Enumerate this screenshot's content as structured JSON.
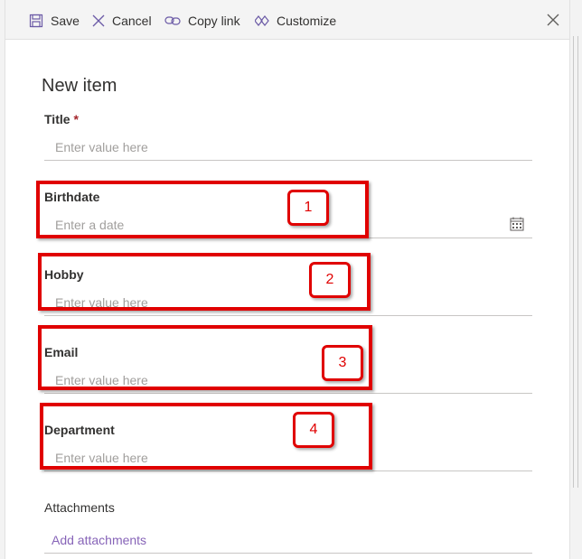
{
  "toolbar": {
    "save_label": "Save",
    "cancel_label": "Cancel",
    "copy_link_label": "Copy link",
    "customize_label": "Customize"
  },
  "form": {
    "title": "New item",
    "fields": [
      {
        "label": "Title",
        "placeholder": "Enter value here",
        "required": "*"
      },
      {
        "label": "Birthdate",
        "placeholder": "Enter a date"
      },
      {
        "label": "Hobby",
        "placeholder": "Enter value here"
      },
      {
        "label": "Email",
        "placeholder": "Enter value here"
      },
      {
        "label": "Department",
        "placeholder": "Enter value here"
      }
    ],
    "attachments": {
      "label": "Attachments",
      "link": "Add attachments"
    }
  },
  "annotations": [
    "1",
    "2",
    "3",
    "4"
  ],
  "colors": {
    "accent": "#8764b8",
    "annotation": "#e00000",
    "required": "#a4262c"
  }
}
